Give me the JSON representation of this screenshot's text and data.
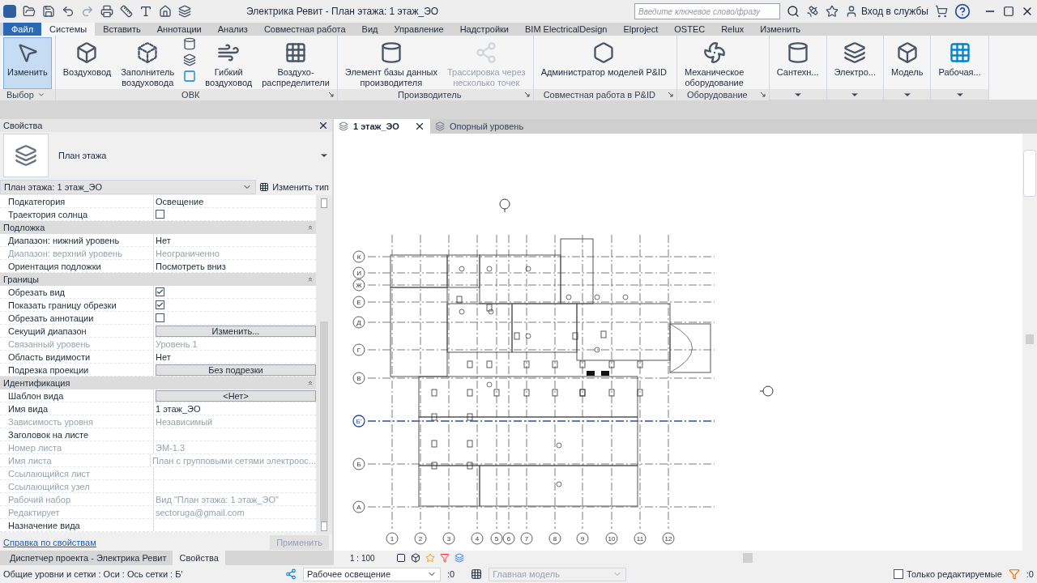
{
  "window": {
    "title": "Электрика Ревит - План этажа: 1 этаж_ЭО",
    "search_placeholder": "Введите ключевое слово/фразу",
    "sign_in": "Вход в службы"
  },
  "menu_tabs": [
    {
      "label": "Файл",
      "kind": "file",
      "selected": false
    },
    {
      "label": "Системы",
      "kind": "tab",
      "selected": true
    },
    {
      "label": "Вставить",
      "kind": "tab",
      "selected": false
    },
    {
      "label": "Аннотации",
      "kind": "tab",
      "selected": false
    },
    {
      "label": "Анализ",
      "kind": "tab",
      "selected": false
    },
    {
      "label": "Совместная работа",
      "kind": "tab",
      "selected": false
    },
    {
      "label": "Вид",
      "kind": "tab",
      "selected": false
    },
    {
      "label": "Управление",
      "kind": "tab",
      "selected": false
    },
    {
      "label": "Надстройки",
      "kind": "tab",
      "selected": false
    },
    {
      "label": "BIM ElectricalDesign",
      "kind": "tab",
      "selected": false
    },
    {
      "label": "Elproject",
      "kind": "tab",
      "selected": false
    },
    {
      "label": "OSTEC",
      "kind": "tab",
      "selected": false
    },
    {
      "label": "Relux",
      "kind": "tab",
      "selected": false
    },
    {
      "label": "Изменить",
      "kind": "tab",
      "selected": false
    }
  ],
  "ribbon_panels": [
    {
      "title": "Выбор",
      "buttons": [
        {
          "kind": "button",
          "label": "Изменить",
          "selected": true,
          "disabled": false
        }
      ]
    },
    {
      "title": "ОВК",
      "buttons": [
        {
          "kind": "button",
          "label": "Воздуховод",
          "selected": false,
          "disabled": false
        },
        {
          "kind": "button",
          "label": "Заполнитель\nвоздуховода",
          "selected": false,
          "disabled": false
        },
        {
          "kind": "stack"
        },
        {
          "kind": "button",
          "label": "Гибкий\nвоздуховод",
          "selected": false,
          "disabled": false
        },
        {
          "kind": "button",
          "label": "Воздухо-\nраспределители",
          "selected": false,
          "disabled": false
        }
      ]
    },
    {
      "title": "Производитель",
      "buttons": [
        {
          "kind": "button",
          "label": "Элемент базы данных\nпроизводителя",
          "selected": false,
          "disabled": false
        },
        {
          "kind": "button",
          "label": "Трассировка через\nнесколько точек",
          "selected": false,
          "disabled": true
        }
      ]
    },
    {
      "title": "Совместная работа в P&ID",
      "buttons": [
        {
          "kind": "button",
          "label": "Администратор моделей P&ID",
          "selected": false,
          "disabled": false
        }
      ]
    },
    {
      "title": "Оборудование",
      "buttons": [
        {
          "kind": "button",
          "label": "Механическое\nоборудование",
          "selected": false,
          "disabled": false
        }
      ]
    },
    {
      "buttons": [
        {
          "kind": "button",
          "label": "Сантехн...",
          "selected": false,
          "disabled": false
        }
      ]
    },
    {
      "buttons": [
        {
          "kind": "button",
          "label": "Электро...",
          "selected": false,
          "disabled": false
        }
      ]
    },
    {
      "buttons": [
        {
          "kind": "button",
          "label": "Модель",
          "selected": false,
          "disabled": false
        }
      ]
    },
    {
      "buttons": [
        {
          "kind": "button",
          "label": "Рабочая...",
          "selected": false,
          "disabled": false
        }
      ]
    }
  ],
  "properties": {
    "title": "Свойства",
    "type_name": "План этажа",
    "instance": "План этажа: 1 этаж_ЭО",
    "edit_type": "Изменить тип",
    "rows": [
      {
        "kind": "text",
        "label": "Подкатегория",
        "value": "Освещение",
        "disabled": false
      },
      {
        "kind": "checkbox",
        "label": "Траектория солнца",
        "checked": false,
        "disabled": false
      },
      {
        "kind": "section",
        "label": "Подложка"
      },
      {
        "kind": "text",
        "label": "Диапазон: нижний уровень",
        "value": "Нет",
        "disabled": false
      },
      {
        "kind": "text",
        "label": "Диапазон: верхний уровень",
        "value": "Неограниченно",
        "disabled": true
      },
      {
        "kind": "text",
        "label": "Ориентация подложки",
        "value": "Посмотреть вниз",
        "disabled": false
      },
      {
        "kind": "section",
        "label": "Границы"
      },
      {
        "kind": "checkbox",
        "label": "Обрезать вид",
        "checked": true,
        "disabled": false
      },
      {
        "kind": "checkbox",
        "label": "Показать границу обрезки",
        "checked": true,
        "disabled": false
      },
      {
        "kind": "checkbox",
        "label": "Обрезать аннотации",
        "checked": false,
        "disabled": false
      },
      {
        "kind": "button",
        "label": "Секущий диапазон",
        "value": "Изменить...",
        "disabled": false
      },
      {
        "kind": "text",
        "label": "Связанный уровень",
        "value": "Уровень 1",
        "disabled": true
      },
      {
        "kind": "text",
        "label": "Область видимости",
        "value": "Нет",
        "disabled": false
      },
      {
        "kind": "button",
        "label": "Подрезка проекции",
        "value": "Без подрезки",
        "disabled": false
      },
      {
        "kind": "section",
        "label": "Идентификация"
      },
      {
        "kind": "button",
        "label": "Шаблон вида",
        "value": "<Нет>",
        "disabled": false
      },
      {
        "kind": "text",
        "label": "Имя вида",
        "value": "1 этаж_ЭО",
        "disabled": false
      },
      {
        "kind": "text",
        "label": "Зависимость уровня",
        "value": "Независимый",
        "disabled": true
      },
      {
        "kind": "text",
        "label": "Заголовок на листе",
        "disabled": false
      },
      {
        "kind": "text",
        "label": "Номер листа",
        "value": "ЭМ-1.3",
        "disabled": true
      },
      {
        "kind": "text",
        "label": "Имя листа",
        "value": "План с групповыми сетями электроос...",
        "disabled": true
      },
      {
        "kind": "text",
        "label": "Ссылающийся лист",
        "disabled": true
      },
      {
        "kind": "text",
        "label": "Ссылающийся узел",
        "disabled": true
      },
      {
        "kind": "text",
        "label": "Рабочий набор",
        "value": "Вид \"План этажа: 1 этаж_ЭО\"",
        "disabled": true
      },
      {
        "kind": "text",
        "label": "Редактирует",
        "value": "sectoruga@gmail.com",
        "disabled": true
      },
      {
        "kind": "text",
        "label": "Назначение вида",
        "disabled": false
      }
    ],
    "help_link": "Справка по свойствам",
    "apply": "Применить",
    "apply_disabled": true
  },
  "bottom_tabs": [
    {
      "label": "Диспетчер проекта - Электрика Ревит",
      "selected": false
    },
    {
      "label": "Свойства",
      "selected": true
    }
  ],
  "view_tabs": [
    {
      "label": "1 этаж_ЭО",
      "selected": true
    },
    {
      "label": "Опорный уровень",
      "selected": false
    }
  ],
  "plan": {
    "row_axes": [
      {
        "label": "К",
        "selected": false
      },
      {
        "label": "И",
        "selected": false
      },
      {
        "label": "Ж",
        "selected": false
      },
      {
        "label": "Е",
        "selected": false
      },
      {
        "label": "Д",
        "selected": false
      },
      {
        "label": "Г",
        "selected": false
      },
      {
        "label": "В",
        "selected": false
      },
      {
        "label": "Б'",
        "selected": true
      },
      {
        "label": "Б",
        "selected": false
      },
      {
        "label": "А",
        "selected": false
      }
    ],
    "column_axes": [
      {
        "label": "1"
      },
      {
        "label": "2"
      },
      {
        "label": "3"
      },
      {
        "label": "4"
      },
      {
        "label": "5"
      },
      {
        "label": "6"
      },
      {
        "label": "7"
      },
      {
        "label": "8"
      },
      {
        "label": "9"
      },
      {
        "label": "10"
      },
      {
        "label": "11"
      },
      {
        "label": "12"
      }
    ]
  },
  "view_bar": {
    "scale": "1 : 100"
  },
  "status_bar": {
    "message": "Общие уровни и сетки : Оси : Ось сетки : Б'",
    "workset": "Рабочее освещение",
    "count": ":0",
    "model": "Главная модель",
    "model_disabled": true,
    "editable_only": {
      "label": "Только редактируемые",
      "checked": false
    },
    "filter_count": ":0"
  }
}
